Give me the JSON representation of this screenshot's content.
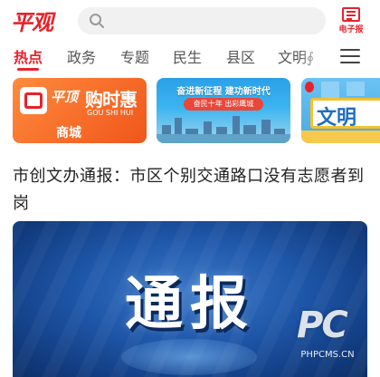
{
  "app": {
    "logo_text": "平观",
    "search_placeholder": "",
    "epaper_label": "电子报",
    "colors": {
      "accent": "#e8212a",
      "text": "#222222",
      "tab_inactive": "#555555"
    }
  },
  "tabs": [
    {
      "label": "热点",
      "active": true
    },
    {
      "label": "政务",
      "active": false
    },
    {
      "label": "专题",
      "active": false
    },
    {
      "label": "民生",
      "active": false
    },
    {
      "label": "县区",
      "active": false
    },
    {
      "label": "文明∮",
      "active": false
    }
  ],
  "banners": [
    {
      "brand": "平顶",
      "title": "购时惠",
      "pinyin": "GOU SHI HUI",
      "tag": "商城"
    },
    {
      "headline": "奋进新征程 建功新时代",
      "sub": "奋民十年 出彩鹰城"
    },
    {
      "headline": "文明"
    }
  ],
  "article": {
    "headline": "市创文办通报：市区个别交通路口没有志愿者到岗",
    "image_title": "通报"
  },
  "watermark": {
    "logo": "PC",
    "site": "PHPCMS.CN"
  },
  "icons": [
    "search-icon",
    "epaper-icon",
    "menu-icon"
  ]
}
